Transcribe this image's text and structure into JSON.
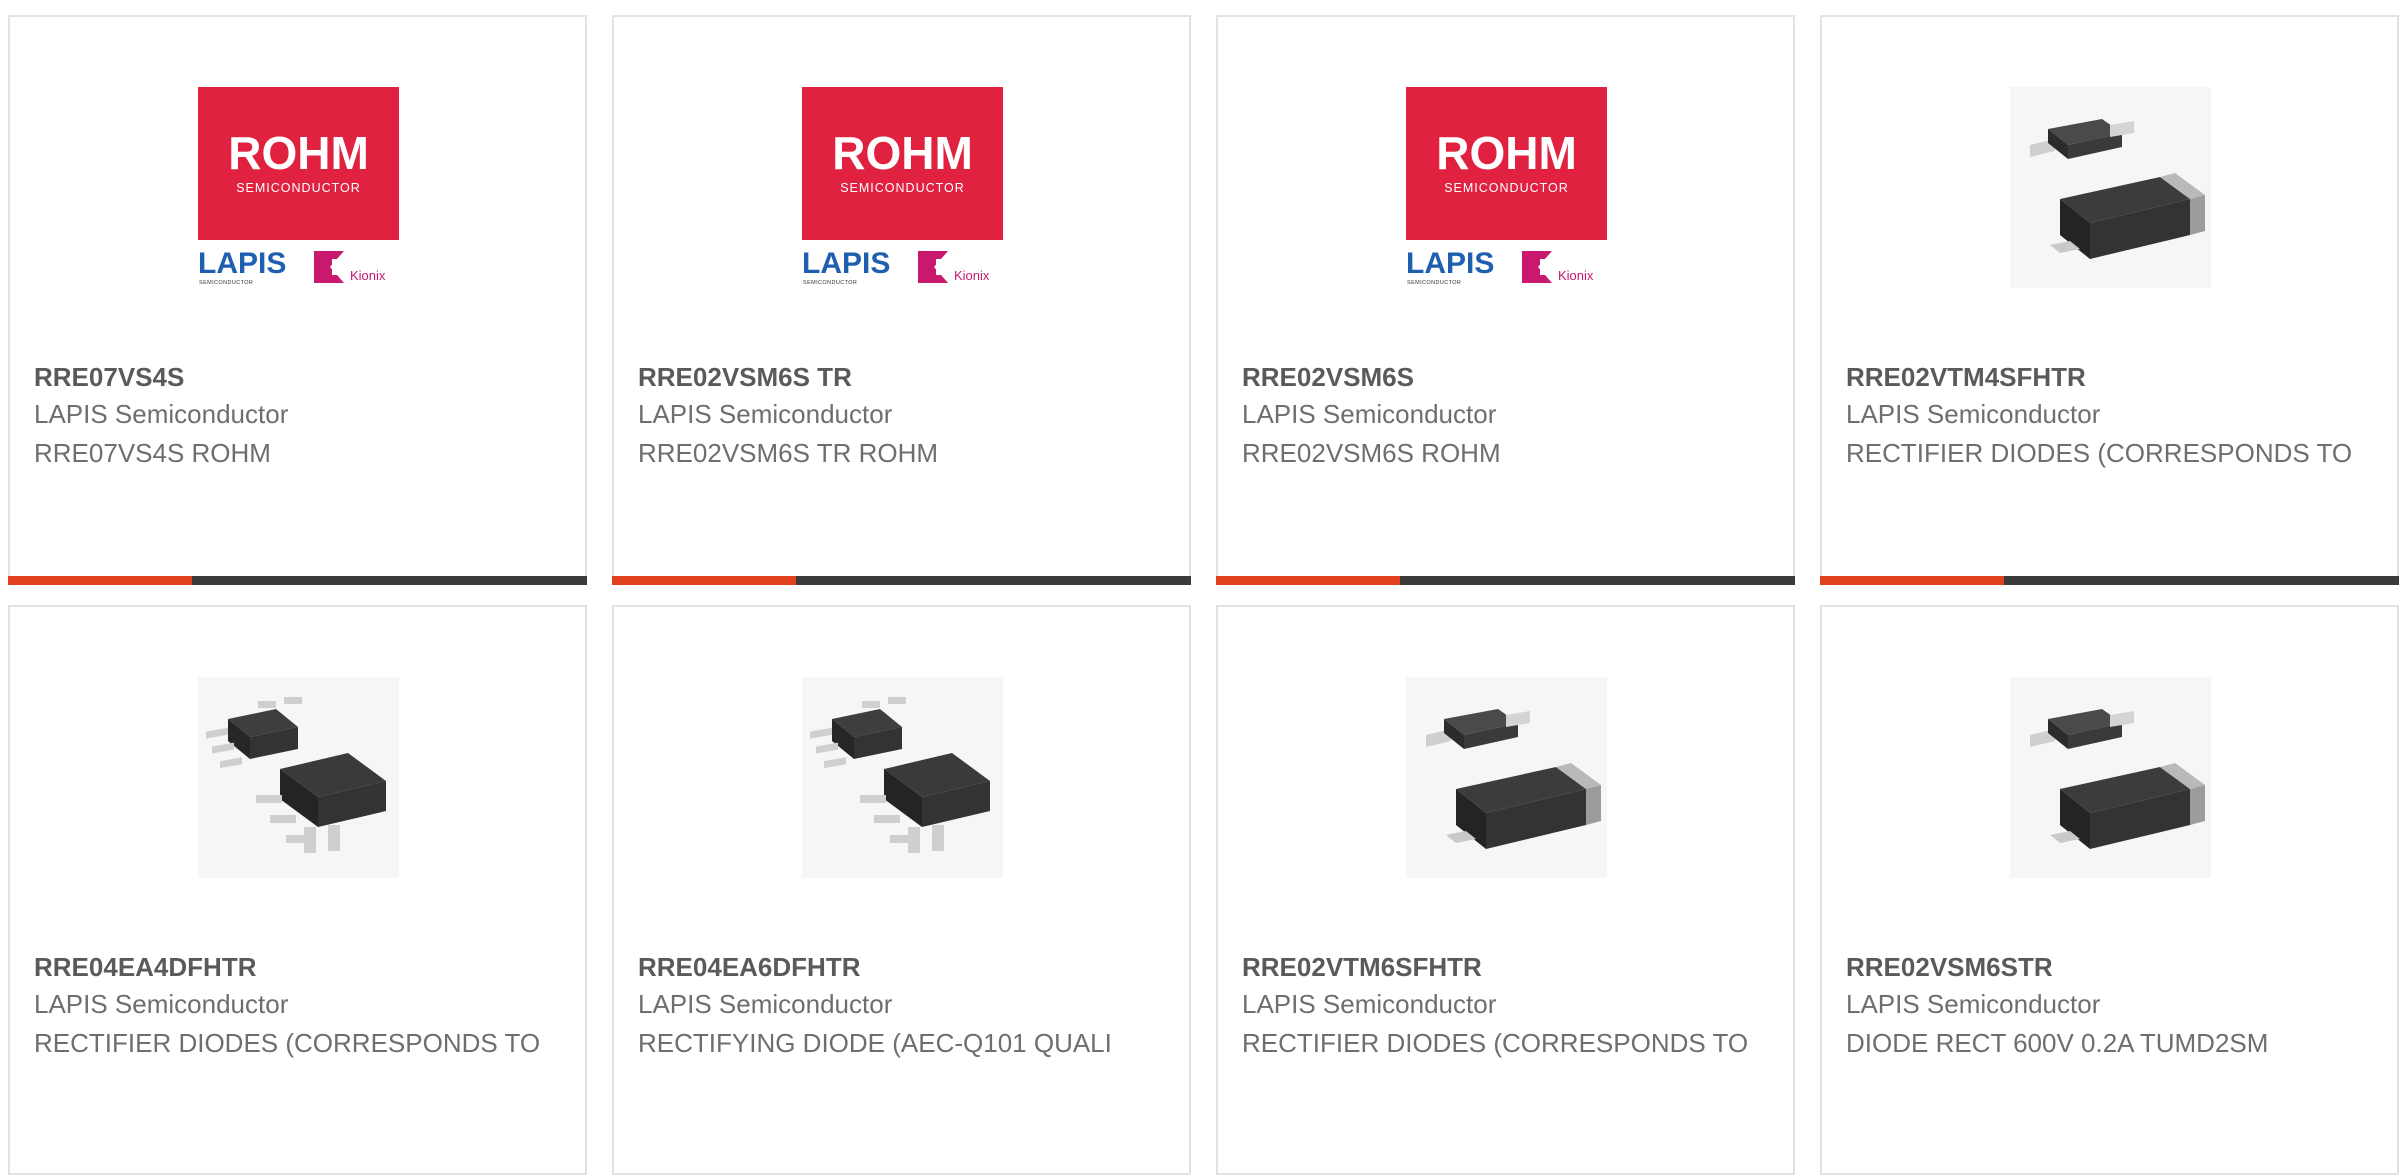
{
  "accent_color": "#e2401e",
  "bar_color": "#3a3a3a",
  "logo": {
    "brand": "ROHM",
    "brand_sub": "SEMICONDUCTOR",
    "lapis": "LAPIS",
    "lapis_sub": "SEMICONDUCTOR",
    "kionix": "Kionix",
    "brand_color": "#e02240",
    "lapis_color": "#1f5fb0",
    "kionix_color": "#c8196e"
  },
  "products": [
    {
      "part": "RRE07VS4S",
      "maker": "LAPIS Semiconductor",
      "desc": "RRE07VS4S ROHM",
      "image": "rohm-lapis-kionix-logo"
    },
    {
      "part": "RRE02VSM6S TR",
      "maker": "LAPIS Semiconductor",
      "desc": "RRE02VSM6S TR ROHM",
      "image": "rohm-lapis-kionix-logo"
    },
    {
      "part": "RRE02VSM6S",
      "maker": "LAPIS Semiconductor",
      "desc": "RRE02VSM6S ROHM",
      "image": "rohm-lapis-kionix-logo"
    },
    {
      "part": "RRE02VTM4SFHTR",
      "maker": "LAPIS Semiconductor",
      "desc": "RECTIFIER DIODES (CORRESPONDS TO",
      "image": "two-lead-diode-package-icon"
    },
    {
      "part": "RRE04EA4DFHTR",
      "maker": "LAPIS Semiconductor",
      "desc": "RECTIFIER DIODES (CORRESPONDS TO",
      "image": "five-lead-sot-package-icon"
    },
    {
      "part": "RRE04EA6DFHTR",
      "maker": "LAPIS Semiconductor",
      "desc": "RECTIFYING DIODE (AEC-Q101 QUALI",
      "image": "five-lead-sot-package-icon"
    },
    {
      "part": "RRE02VTM6SFHTR",
      "maker": "LAPIS Semiconductor",
      "desc": "RECTIFIER DIODES (CORRESPONDS TO",
      "image": "two-lead-diode-package-icon"
    },
    {
      "part": "RRE02VSM6STR",
      "maker": "LAPIS Semiconductor",
      "desc": "DIODE RECT 600V 0.2A TUMD2SM",
      "image": "two-lead-diode-package-icon"
    }
  ]
}
